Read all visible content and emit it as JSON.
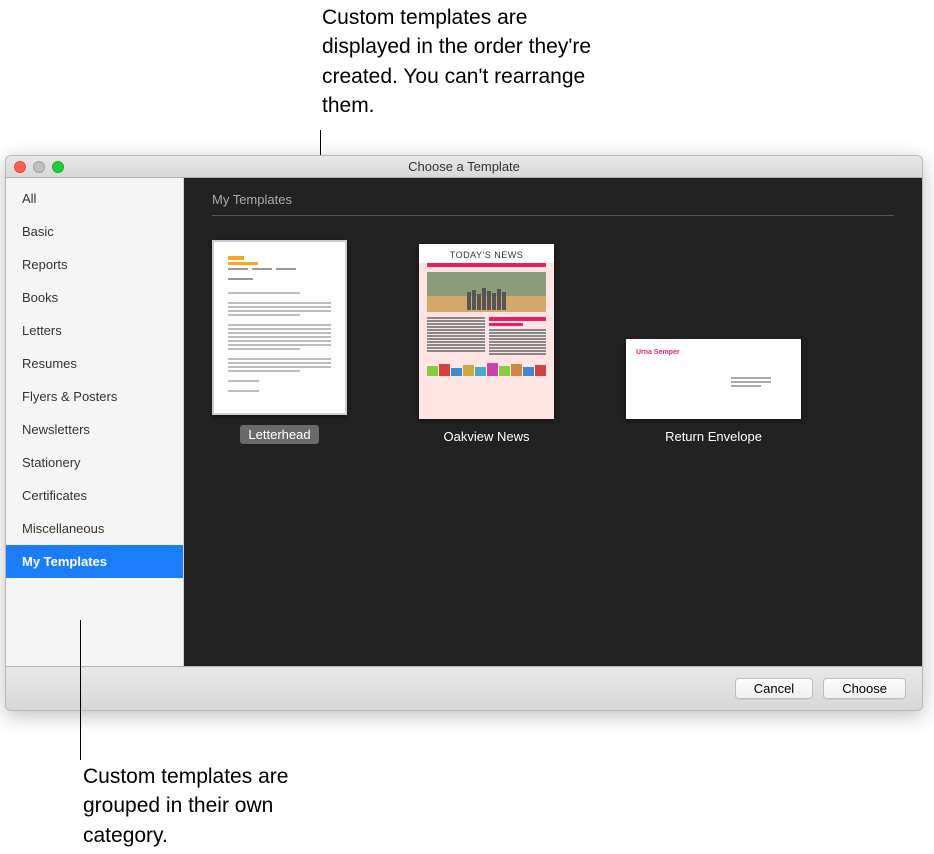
{
  "annotations": {
    "top": "Custom templates are displayed in the order they're created. You can't rearrange them.",
    "bottom": "Custom templates are grouped in their own category."
  },
  "window": {
    "title": "Choose a Template"
  },
  "sidebar": {
    "items": [
      {
        "label": "All",
        "selected": false
      },
      {
        "label": "Basic",
        "selected": false
      },
      {
        "label": "Reports",
        "selected": false
      },
      {
        "label": "Books",
        "selected": false
      },
      {
        "label": "Letters",
        "selected": false
      },
      {
        "label": "Resumes",
        "selected": false
      },
      {
        "label": "Flyers & Posters",
        "selected": false
      },
      {
        "label": "Newsletters",
        "selected": false
      },
      {
        "label": "Stationery",
        "selected": false
      },
      {
        "label": "Certificates",
        "selected": false
      },
      {
        "label": "Miscellaneous",
        "selected": false
      },
      {
        "label": "My Templates",
        "selected": true
      }
    ]
  },
  "main": {
    "section_title": "My Templates",
    "templates": [
      {
        "label": "Letterhead",
        "selected": true
      },
      {
        "label": "Oakview News",
        "selected": false
      },
      {
        "label": "Return Envelope",
        "selected": false
      }
    ],
    "news_headline": "TODAY'S NEWS"
  },
  "footer": {
    "cancel": "Cancel",
    "choose": "Choose"
  },
  "envelope_name": "Urna Semper"
}
